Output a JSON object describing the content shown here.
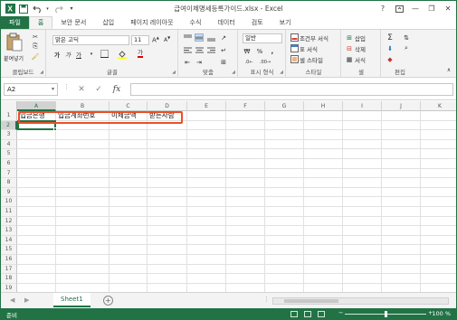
{
  "window": {
    "title": "급여이체명세등록가이드.xlsx - Excel",
    "accent": "#217346"
  },
  "quick_access": [
    "save-icon",
    "undo-icon",
    "redo-icon",
    "customize-icon"
  ],
  "window_controls": {
    "help": "?",
    "minimize": "—",
    "restore": "❐",
    "close": "✕"
  },
  "tabs": [
    {
      "label": "파일"
    },
    {
      "label": "홈"
    },
    {
      "label": "보안 문서"
    },
    {
      "label": "삽입"
    },
    {
      "label": "페이지 레이아웃"
    },
    {
      "label": "수식"
    },
    {
      "label": "데이터"
    },
    {
      "label": "검토"
    },
    {
      "label": "보기"
    }
  ],
  "ribbon": {
    "clipboard": {
      "paste_label": "붙여넣기",
      "group_label": "클립보드"
    },
    "font": {
      "name": "맑은 고딕",
      "size": "11",
      "group_label": "글꼴",
      "underline_button": "가",
      "highlight_button": "가"
    },
    "alignment": {
      "group_label": "맞춤"
    },
    "number": {
      "format": "일반",
      "group_label": "표시 형식"
    },
    "styles": {
      "conditional": "조건부 서식",
      "table": "표 서식",
      "cell": "셀 스타일",
      "group_label": "스타일"
    },
    "cells": {
      "insert": "삽입",
      "delete": "삭제",
      "format": "서식",
      "group_label": "셀"
    },
    "editing": {
      "group_label": "편집"
    }
  },
  "formula_bar": {
    "name_box": "A2",
    "formula": "",
    "fx": "fx"
  },
  "columns": [
    "A",
    "B",
    "C",
    "D",
    "E",
    "F",
    "G",
    "H",
    "I",
    "J",
    "K"
  ],
  "rows": [
    "1",
    "2",
    "3",
    "4",
    "5",
    "6",
    "7",
    "8",
    "9",
    "10",
    "11",
    "12",
    "13",
    "14",
    "15",
    "16",
    "17",
    "18",
    "19"
  ],
  "header_row": [
    "입금은행",
    "입금계좌번호",
    "이체금액",
    "받는사람"
  ],
  "selected_cell": "A2",
  "sheets": [
    {
      "name": "Sheet1",
      "active": true
    }
  ],
  "status": {
    "ready": "준비",
    "zoom": "100 %"
  }
}
